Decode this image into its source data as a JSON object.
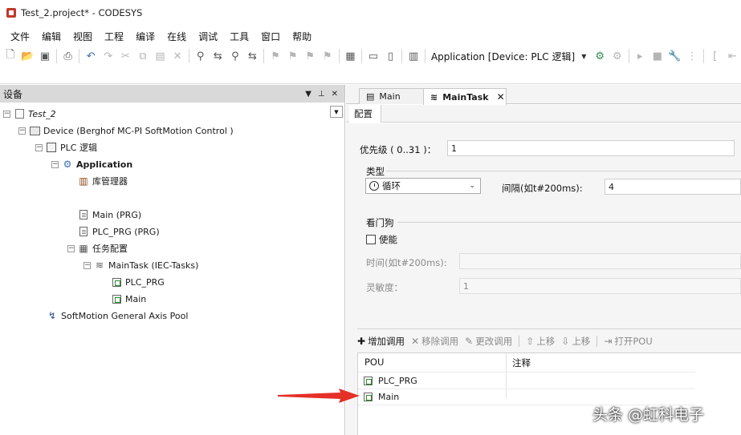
{
  "window": {
    "title": "Test_2.project* - CODESYS"
  },
  "menu": [
    "文件",
    "编辑",
    "视图",
    "工程",
    "编译",
    "在线",
    "调试",
    "工具",
    "窗口",
    "帮助"
  ],
  "toolbar": {
    "app_selector": "Application [Device: PLC 逻辑]",
    "icons": [
      "new-project-icon",
      "open-project-icon",
      "save-icon",
      "print-icon",
      "undo-icon",
      "redo-icon",
      "cut-icon",
      "copy-icon",
      "paste-icon",
      "delete-icon",
      "find-icon",
      "find-replace-icon",
      "bookmark-toggle-icon",
      "bookmark-next-icon",
      "object-properties-icon",
      "add-object-icon",
      "add-folder-icon",
      "select-all-icon",
      "login-icon",
      "logout-icon",
      "run-icon",
      "stop-icon",
      "reset-icon",
      "breakpoint-icon",
      "step-over-icon"
    ]
  },
  "left_panel": {
    "title": "设备",
    "tree": {
      "project": "Test_2",
      "device": "Device (Berghof MC-PI SoftMotion Control )",
      "plc_logic": "PLC 逻辑",
      "application": "Application",
      "library_manager": "库管理器",
      "main_prg": "Main (PRG)",
      "plc_prg": "PLC_PRG (PRG)",
      "task_config": "任务配置",
      "main_task": "MainTask (IEC-Tasks)",
      "task_call_plc_prg": "PLC_PRG",
      "task_call_main": "Main",
      "axis_pool": "SoftMotion General Axis Pool"
    }
  },
  "editor": {
    "tabs": [
      {
        "label": "Main",
        "active": false
      },
      {
        "label": "MainTask",
        "active": true
      }
    ],
    "close_glyph": "✕",
    "subtab": "配置",
    "priority": {
      "label": "优先级 ( 0..31 )：",
      "value": "1"
    },
    "type": {
      "group_label": "类型",
      "selected": "循环",
      "interval_label": "间隔(如t#200ms):",
      "interval_value": "4"
    },
    "watchdog": {
      "group_label": "看门狗",
      "enable_label": "使能",
      "enabled": false,
      "time_label": "时间(如t#200ms):",
      "time_value": "",
      "sensitivity_label": "灵敏度：",
      "sensitivity_value": "1"
    },
    "call_toolbar": {
      "add_call": "增加调用",
      "remove_call": "移除调用",
      "change_call": "更改调用",
      "move_up_1": "上移",
      "move_up_2": "上移",
      "open_pou": "打开POU"
    },
    "pou_table": {
      "columns": [
        "POU",
        "注释"
      ],
      "rows": [
        {
          "pou": "PLC_PRG",
          "comment": ""
        },
        {
          "pou": "Main",
          "comment": ""
        }
      ]
    }
  },
  "overlay": {
    "watermark": "头条 @虹科电子",
    "arrow_color": "#e53027"
  }
}
